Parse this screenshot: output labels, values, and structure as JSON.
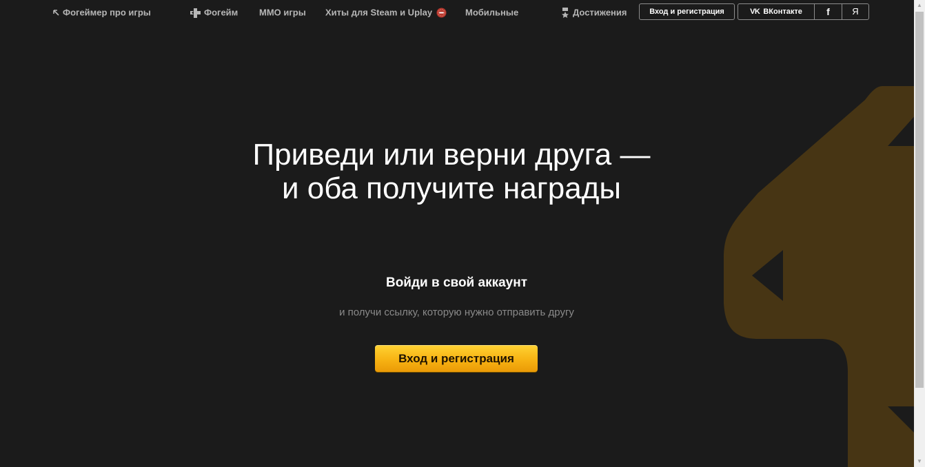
{
  "nav": {
    "back_link": "Фогеймер про игры",
    "fogame": "Фогейм",
    "mmo": "ММО игры",
    "steam_hits": "Хиты для Steam и Uplay",
    "mobile": "Мобильные",
    "achievements": "Достижения",
    "login_button": "Вход и регистрация",
    "social": {
      "vk": "ВКонтакте",
      "vk_mark": "VK",
      "facebook": "f",
      "yandex": "Я"
    }
  },
  "hero": {
    "title_line1": "Приведи или верни друга —",
    "title_line2": "и оба получите награды"
  },
  "login": {
    "heading": "Войди в свой аккаунт",
    "subtext": "и получи ссылку, которую нужно отправить другу",
    "cta": "Вход и регистрация"
  },
  "scrollbar": {
    "up": "▲",
    "down": "▼"
  },
  "colors": {
    "background": "#1b1b1b",
    "accent": "#f7b313",
    "brand_shape": "#473514",
    "badge_red": "#b8382e"
  }
}
